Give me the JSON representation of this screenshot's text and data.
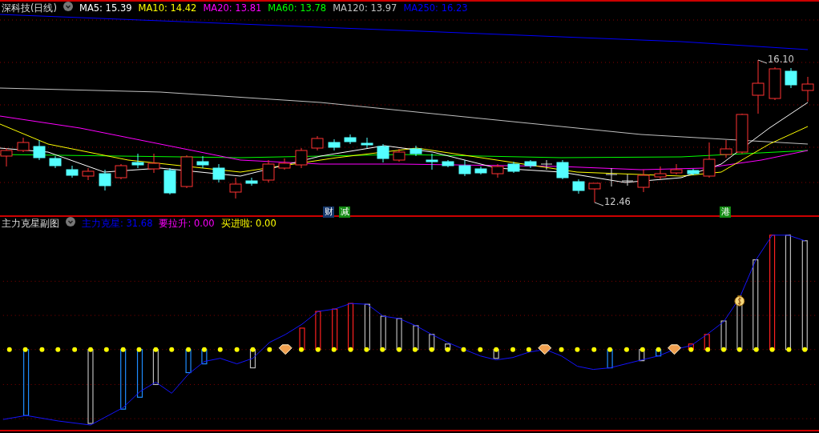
{
  "price_panel": {
    "title": "深科技(日线)",
    "indicators": [
      {
        "label": "MA5: 15.39",
        "color": "#ffffff"
      },
      {
        "label": "MA10: 14.42",
        "color": "#ffff00"
      },
      {
        "label": "MA20: 13.81",
        "color": "#ff00ff"
      },
      {
        "label": "MA60: 13.78",
        "color": "#00ff00"
      },
      {
        "label": "MA120: 13.97",
        "color": "#c0c0c0"
      },
      {
        "label": "MA250: 16.23",
        "color": "#0000ff"
      }
    ],
    "annotations": [
      {
        "label": "16.10",
        "kind": "high"
      },
      {
        "label": "12.46",
        "kind": "low"
      }
    ],
    "event_tags": [
      {
        "label": "财",
        "color": "#16386c"
      },
      {
        "label": "减",
        "color": "#128a12"
      },
      {
        "label": "港",
        "color": "#128a12"
      }
    ]
  },
  "indicator_panel": {
    "title": "主力克星副图",
    "indicators": [
      {
        "label": "主力克星: 31.68",
        "color": "#0000ff"
      },
      {
        "label": "要拉升: 0.00",
        "color": "#ff00ff"
      },
      {
        "label": "买进啦: 0.00",
        "color": "#ffff00"
      }
    ]
  }
}
